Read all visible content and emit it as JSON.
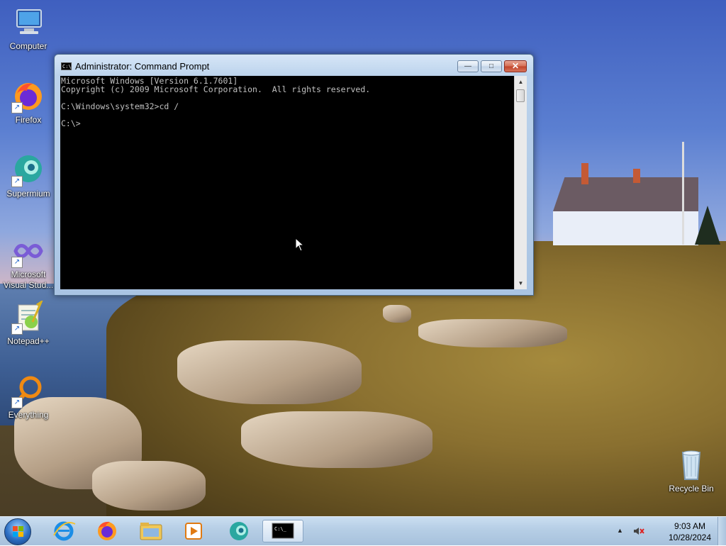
{
  "desktop": {
    "icons": [
      {
        "label": "Computer",
        "icon": "computer-icon"
      },
      {
        "label": "Firefox",
        "icon": "firefox-icon"
      },
      {
        "label": "Supermium",
        "icon": "supermium-icon"
      },
      {
        "label": "Microsoft Visual Stud...",
        "icon": "visual-studio-icon"
      },
      {
        "label": "Notepad++",
        "icon": "notepadpp-icon"
      },
      {
        "label": "Everything",
        "icon": "everything-icon"
      },
      {
        "label": "Recycle Bin",
        "icon": "recycle-bin-icon"
      }
    ]
  },
  "window": {
    "title": "Administrator: Command Prompt",
    "icon_text": "C:\\",
    "buttons": {
      "minimize": "—",
      "maximize": "□",
      "close": "✕"
    },
    "console_lines": [
      "Microsoft Windows [Version 6.1.7601]",
      "Copyright (c) 2009 Microsoft Corporation.  All rights reserved.",
      "",
      "C:\\Windows\\system32>cd /",
      "",
      "C:\\>"
    ]
  },
  "taskbar": {
    "pinned": [
      "internet-explorer-icon",
      "firefox-icon",
      "file-explorer-icon",
      "media-player-icon",
      "supermium-icon",
      "command-prompt-icon"
    ],
    "active_app_icon_text": "C:\\_",
    "clock": {
      "time": "9:03 AM",
      "date": "10/28/2024"
    },
    "tray_arrow": "▲"
  },
  "colors": {
    "console_bg": "#000000",
    "console_text": "#c0c0c0",
    "close_button": "#c0432a",
    "taskbar": "#b7cfe6"
  }
}
